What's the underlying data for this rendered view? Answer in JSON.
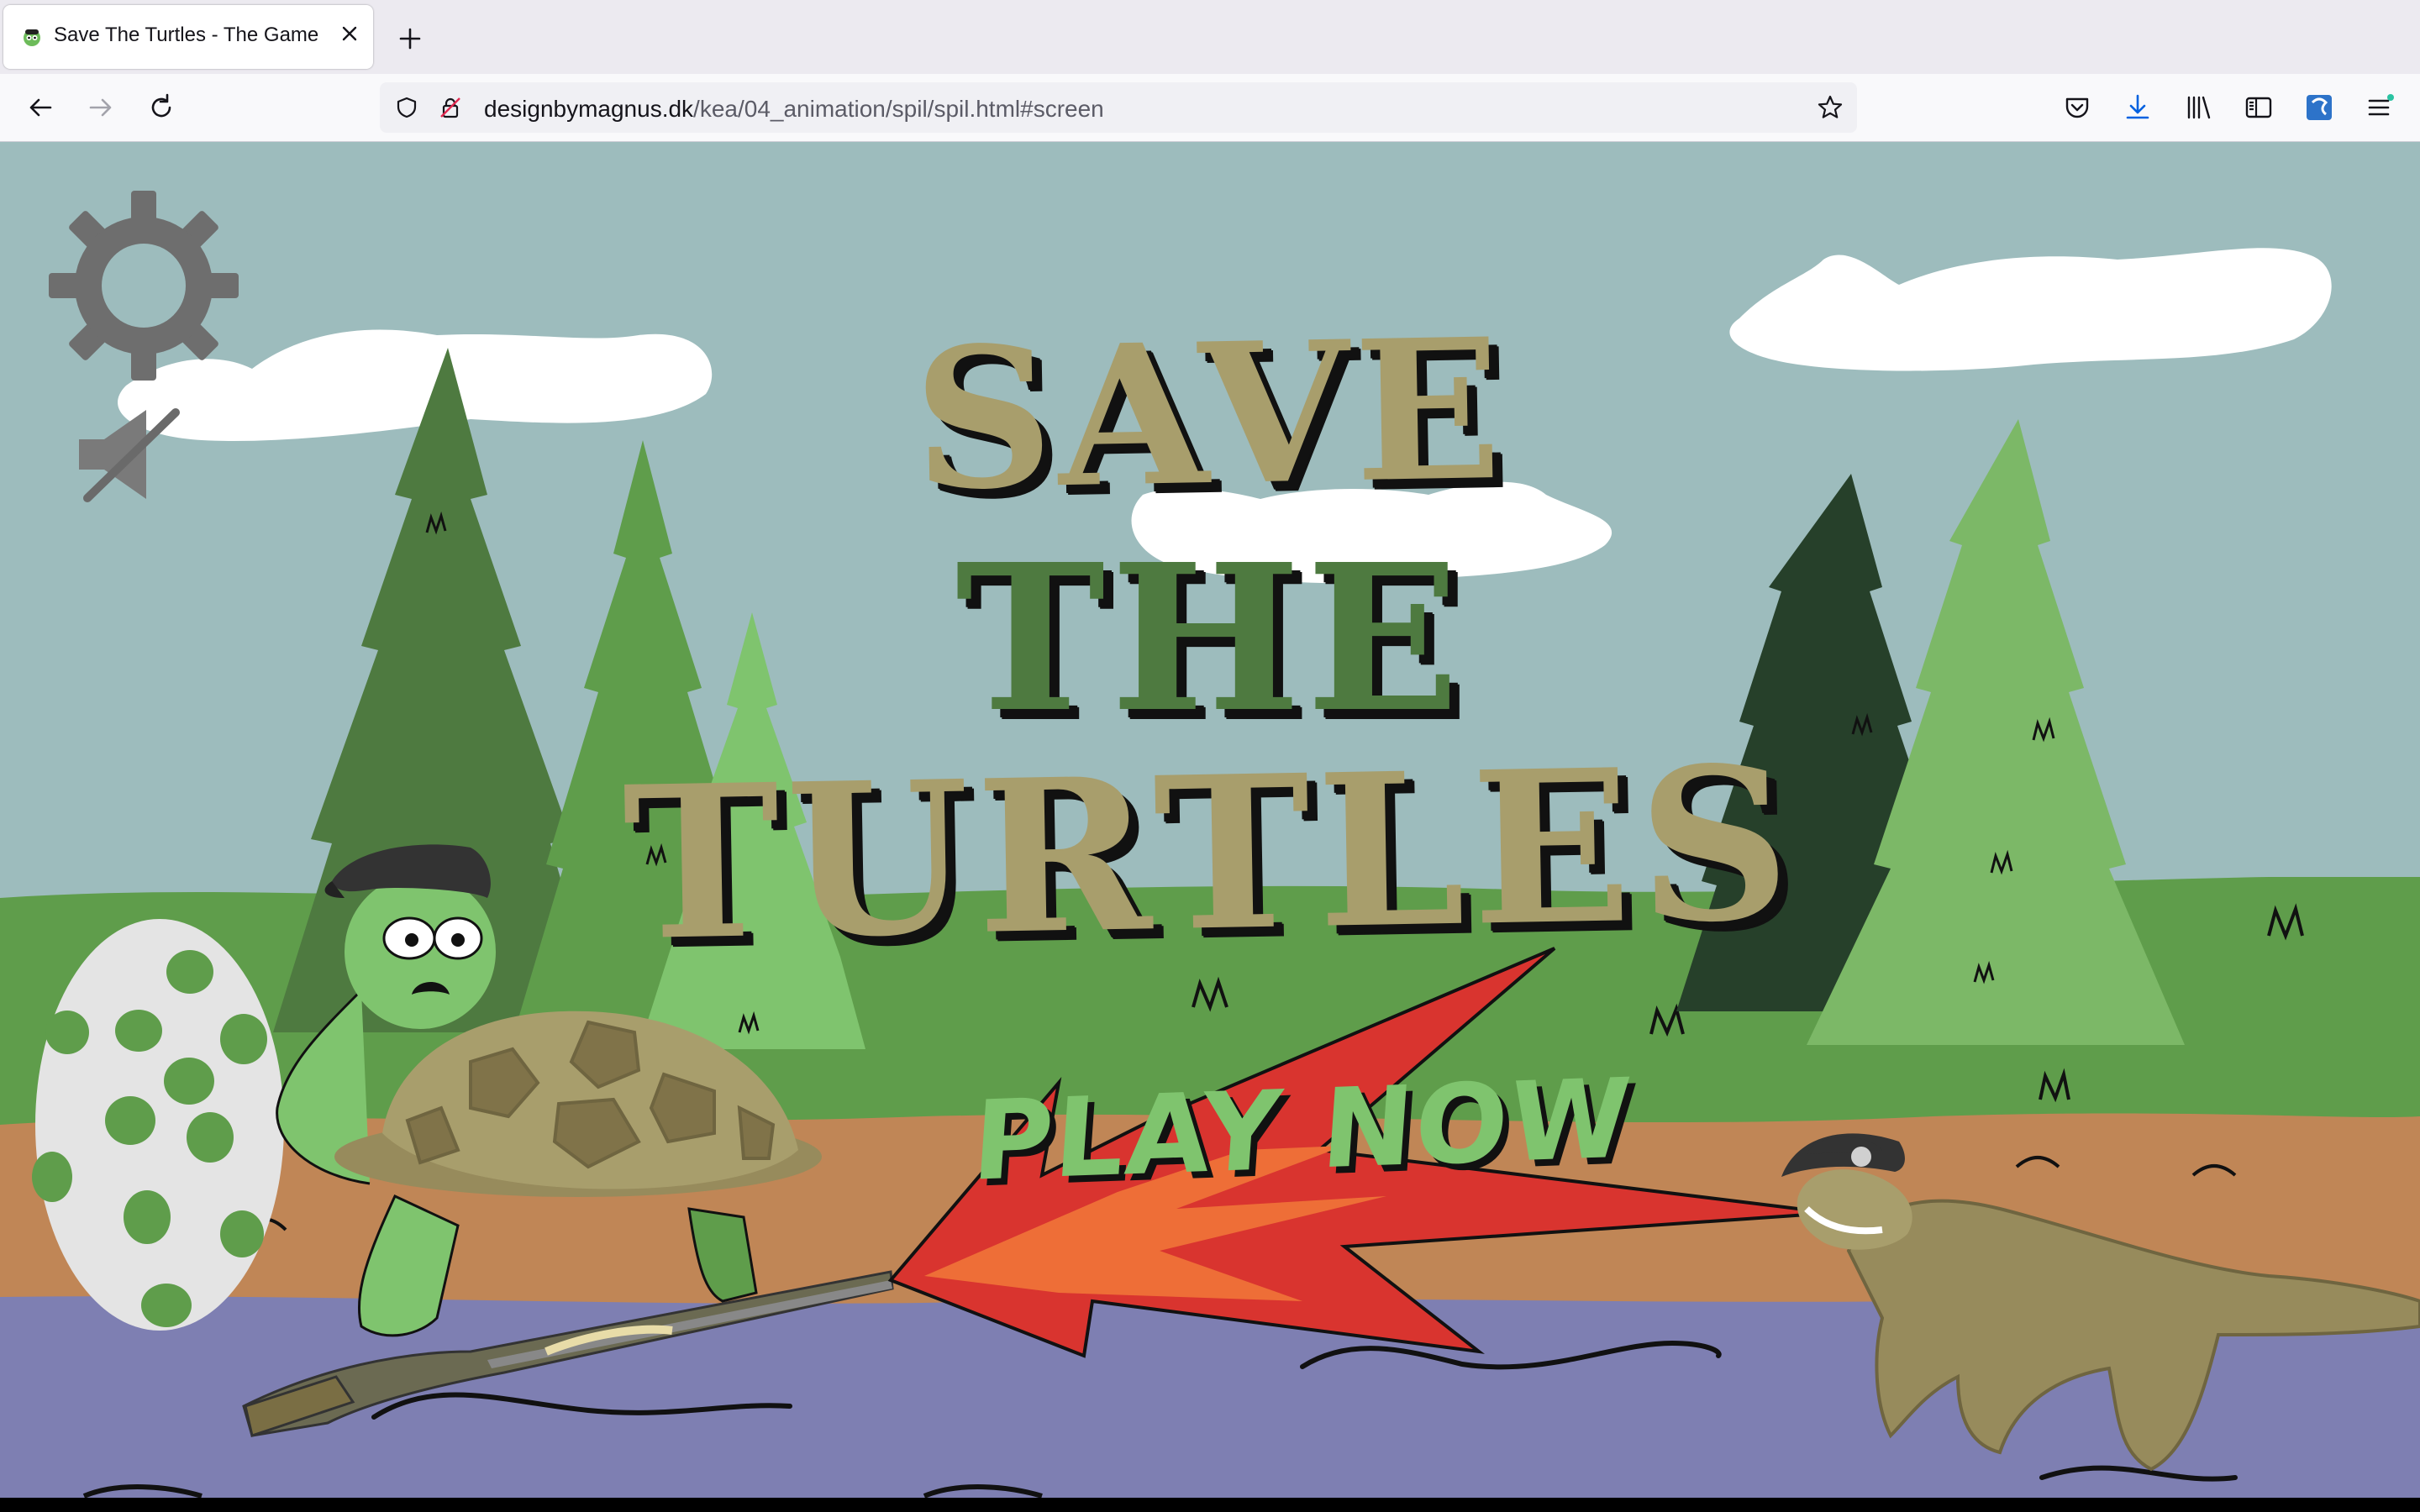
{
  "browser": {
    "tab": {
      "title": "Save The Turtles - The Game"
    },
    "url": {
      "host": "designbymagnus.dk",
      "path": "/kea/04_animation/spil/spil.html#screen"
    }
  },
  "game": {
    "title_lines": [
      "SAVE",
      "THE",
      "TURTLES"
    ],
    "play_label": "PLAY NOW"
  },
  "colors": {
    "sky": "#9dbcbd",
    "grass": "#5f9d4b",
    "dirt": "#c08656",
    "water": "#7e7fb2",
    "title_tan": "#a89e6c",
    "title_green": "#4e7a40",
    "play_arrow": "#d9342f",
    "play_text": "#7fc46e"
  },
  "icons": [
    "settings-gear-icon",
    "sound-muted-icon",
    "back-arrow-icon",
    "forward-arrow-icon",
    "reload-icon",
    "shield-icon",
    "insecure-lock-icon",
    "bookmark-star-icon",
    "pocket-icon",
    "download-icon",
    "library-icon",
    "sidebar-icon",
    "extension-icon",
    "menu-icon"
  ]
}
